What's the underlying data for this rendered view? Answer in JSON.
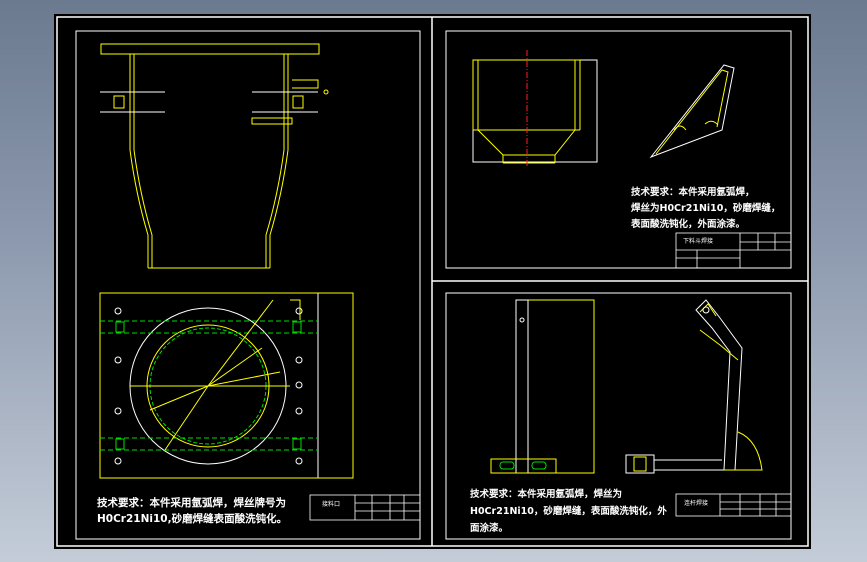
{
  "notes": {
    "sheet1_line1": "技术要求：本件采用氩弧焊，焊丝牌号为",
    "sheet1_line2": "H0Cr21Ni10,砂磨焊缝表面酸洗钝化。",
    "sheet2_line1": "技术要求：本件采用氩弧焊，",
    "sheet2_line2": "焊丝为H0Cr21Ni10，砂磨焊缝，",
    "sheet2_line3": "表面酸洗钝化，外面涂漆。",
    "sheet3_line1": "技术要求：本件采用氩弧焊，焊丝为",
    "sheet3_line2": "H0Cr21Ni10，砂磨焊缝，表面酸洗钝化，外",
    "sheet3_line3": "面涂漆。"
  },
  "title_blocks": {
    "sheet1_name": "接料口",
    "sheet2_name": "下料斗焊接",
    "sheet3_name": "连杆焊接"
  },
  "colors": {
    "background_gradient": [
      "#6c7a90",
      "#c4ccd8"
    ],
    "canvas": "#000000",
    "outline": "#ffffff",
    "geometry": "#ffff00",
    "centerline": "#ff2020",
    "hidden": "#00dd00"
  }
}
